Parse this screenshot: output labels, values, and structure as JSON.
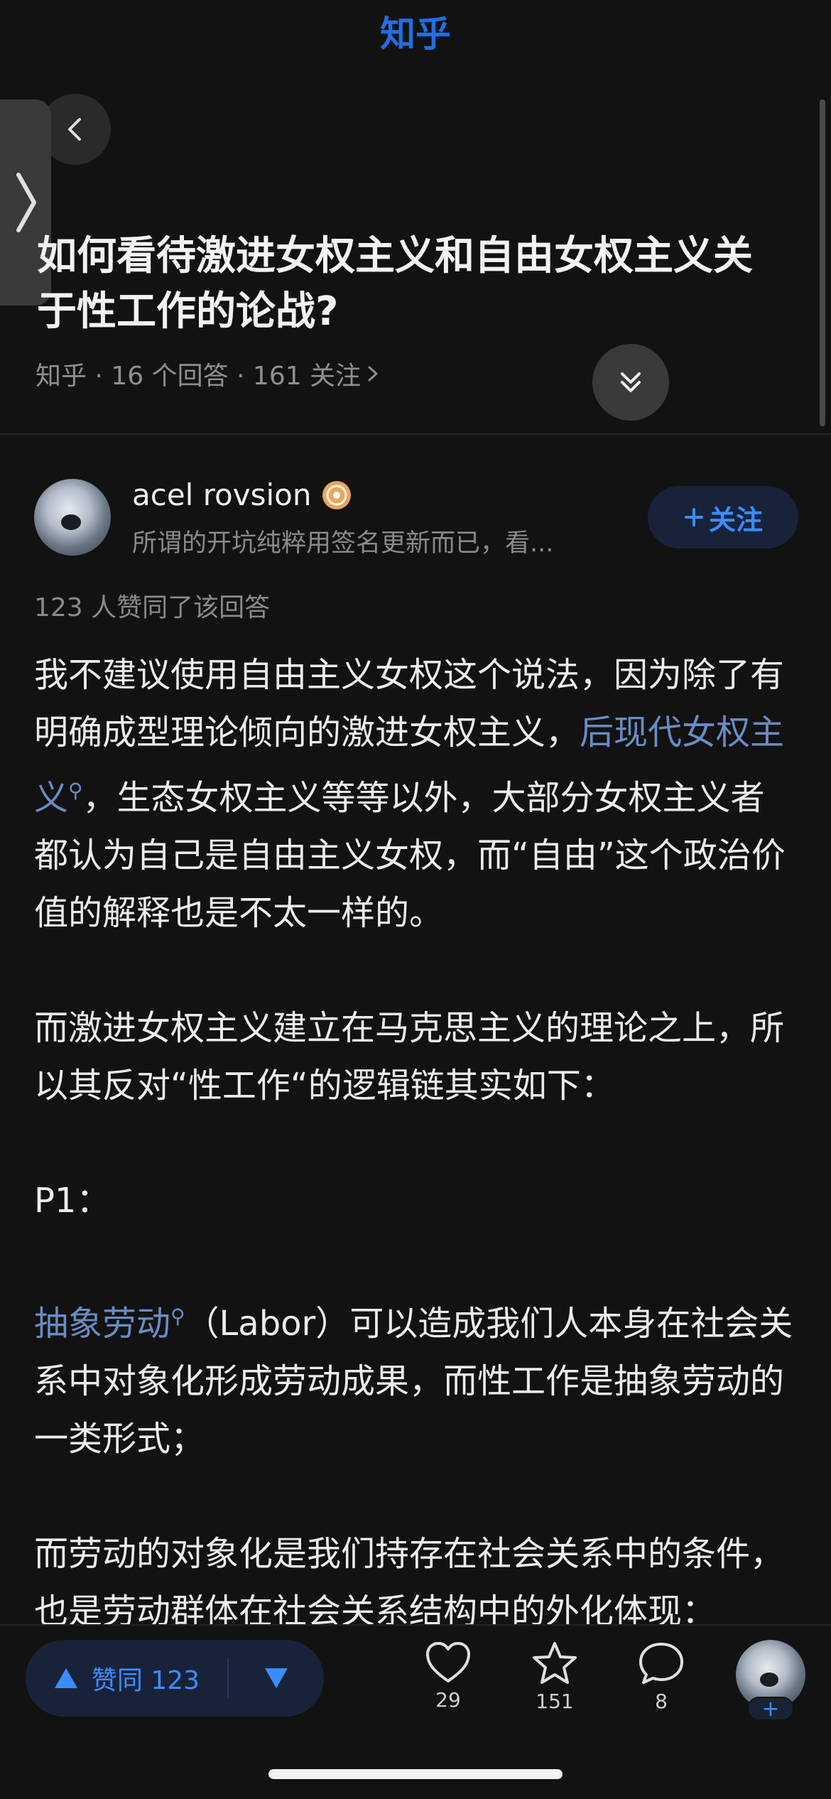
{
  "header": {
    "brand": "知乎",
    "question_title": "如何看待激进女权主义和自由女权主义关于性工作的论战?",
    "meta": "知乎 · 16 个回答 · 161 关注"
  },
  "author": {
    "name": "acel rovsion",
    "bio": "所谓的开坑纯粹用签名更新而已，看...",
    "follow_label": "关注"
  },
  "vote_summary": "123 人赞同了该回答",
  "content": {
    "p1_before": "我不建议使用自由主义女权这个说法，因为除了有明确成型理论倾向的激进女权主义，",
    "p1_link": "后现代女权主义",
    "p1_after": "，生态女权主义等等以外，大部分女权主义者都认为自己是自由主义女权，而“自由”这个政治价值的解释也是不太一样的。",
    "p2": "而激进女权主义建立在马克思主义的理论之上，所以其反对“性工作“的逻辑链其实如下：",
    "p3": "P1：",
    "p4_link": "抽象劳动",
    "p4_after": "（Labor）可以造成我们人本身在社会关系中对象化形成劳动成果，而性工作是抽象劳动的一类形式；",
    "p5": "而劳动的对象化是我们持存在社会关系中的条件，也是劳动群体在社会关系结构中的外化体现："
  },
  "bottom_bar": {
    "vote_label": "赞同 123",
    "like_count": "29",
    "favorite_count": "151",
    "comment_count": "8",
    "add_label": "+"
  },
  "colors": {
    "background": "#121212",
    "accent": "#3d8cff",
    "link": "#6b8cc4",
    "brand": "#1f6fe6"
  },
  "icons": [
    "back-arrow-icon",
    "side-handle-icon",
    "collapse-icon",
    "search-icon",
    "vote-up-icon",
    "vote-down-icon",
    "heart-icon",
    "star-icon",
    "comment-icon"
  ]
}
